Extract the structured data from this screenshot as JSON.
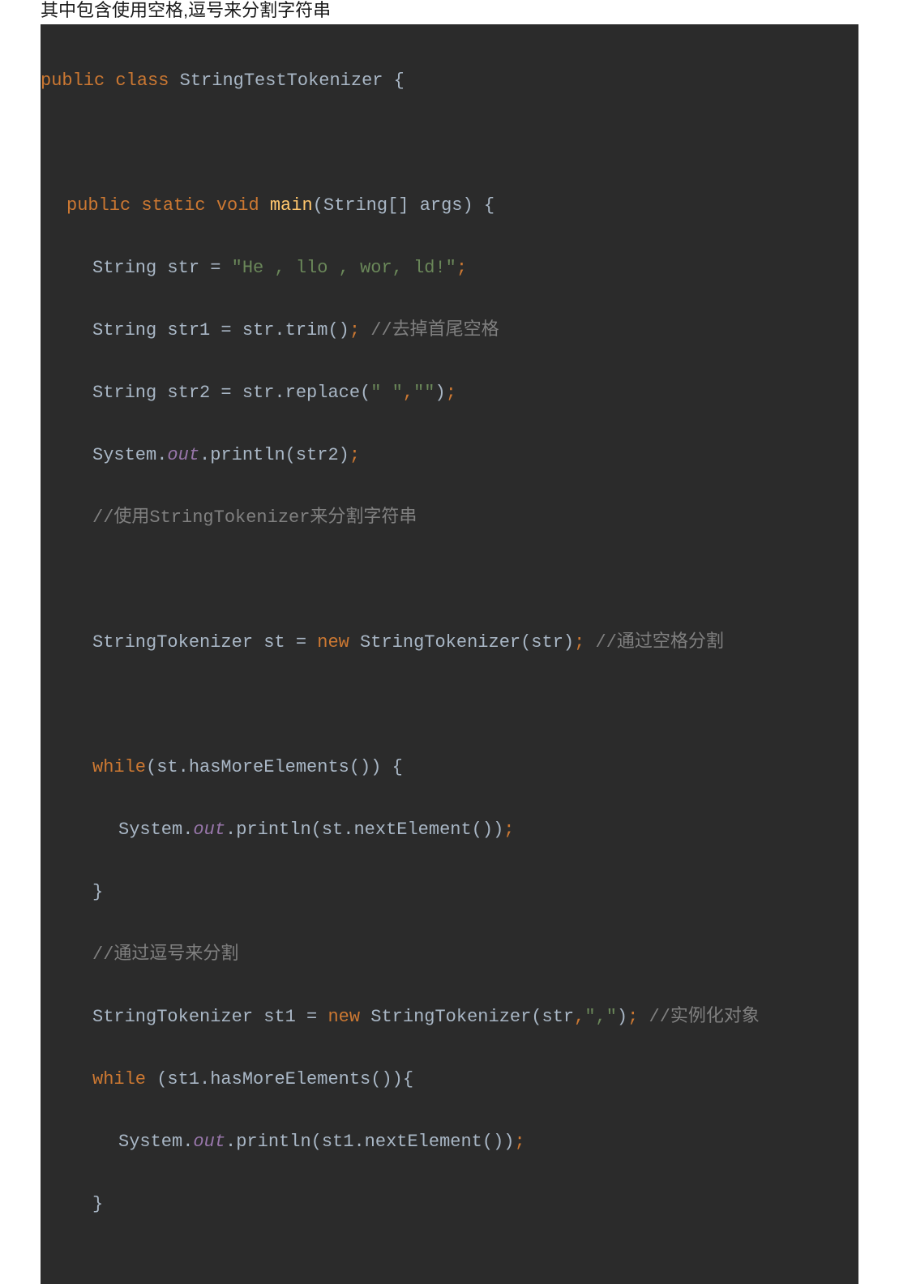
{
  "header": {
    "text": "其中包含使用空格,逗号来分割字符串"
  },
  "code": {
    "l1": {
      "kw1": "public",
      "kw2": "class",
      "name": "StringTestTokenizer",
      "brace": " {"
    },
    "l3": {
      "kw1": "public",
      "kw2": "static",
      "kw3": "void",
      "mname": "main",
      "params": "(String[] args) {"
    },
    "l4": {
      "t1": "String str = ",
      "str": "\"He , llo , wor, ld!\"",
      "semi": ";"
    },
    "l5": {
      "t1": "String str1 = str.trim()",
      "semi": ";",
      "cmt": " //去掉首尾空格"
    },
    "l6": {
      "t1": "String str2 = str.replace(",
      "s1": "\" \"",
      "comma": ",",
      "s2": "\"\"",
      "t2": ")",
      "semi": ";"
    },
    "l7": {
      "t1": "System.",
      "fld": "out",
      "t2": ".println(str2)",
      "semi": ";"
    },
    "l8": {
      "cmt": "//使用StringTokenizer来分割字符串"
    },
    "l10": {
      "t1": "StringTokenizer st = ",
      "kw": "new",
      "t2": " StringTokenizer(str)",
      "semi": ";",
      "cmt": " //通过空格分割"
    },
    "l12": {
      "kw": "while",
      "t1": "(st.hasMoreElements()) {"
    },
    "l13": {
      "t1": "System.",
      "fld": "out",
      "t2": ".println(st.nextElement())",
      "semi": ";"
    },
    "l14": {
      "brace": "}"
    },
    "l15": {
      "cmt": "//通过逗号来分割"
    },
    "l16": {
      "t1": "StringTokenizer st1 = ",
      "kw": "new",
      "t2": " StringTokenizer(str",
      "comma": ",",
      "s1": "\",\"",
      "t3": ")",
      "semi": ";",
      "cmt": " //实例化对象"
    },
    "l17": {
      "kw": "while",
      "t1": " (st1.hasMoreElements()){"
    },
    "l18": {
      "t1": "System.",
      "fld": "out",
      "t2": ".println(st1.nextElement())",
      "semi": ";"
    },
    "l19": {
      "brace": "}"
    }
  }
}
